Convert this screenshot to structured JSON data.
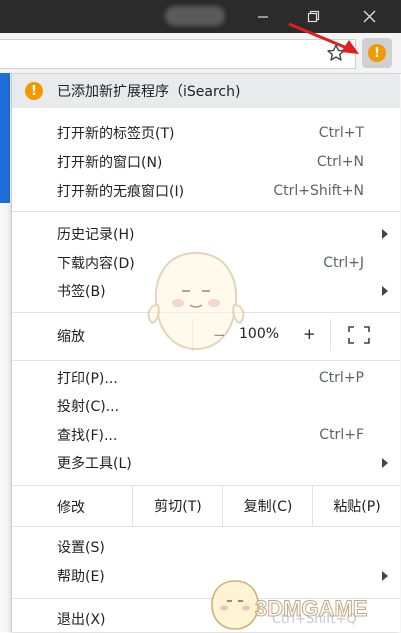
{
  "colors": {
    "accent": "#f29900",
    "blue": "#1e6fd9",
    "titlebar": "#2b2b2b"
  },
  "window_controls": {
    "minimize": "—",
    "maximize": "❐",
    "close": "✕"
  },
  "toolbar": {
    "bookmark_icon": "star-icon",
    "extension_icon": "alert-icon",
    "extension_glyph": "!"
  },
  "menu": {
    "notice": {
      "icon": "!",
      "text": "已添加新扩展程序（iSearch)"
    },
    "items": [
      {
        "label": "打开新的标签页(T)",
        "shortcut": "Ctrl+T"
      },
      {
        "label": "打开新的窗口(N)",
        "shortcut": "Ctrl+N"
      },
      {
        "label": "打开新的无痕窗口(I)",
        "shortcut": "Ctrl+Shift+N"
      },
      {
        "label": "历史记录(H)",
        "shortcut": ""
      },
      {
        "label": "下载内容(D)",
        "shortcut": "Ctrl+J"
      },
      {
        "label": "书签(B)",
        "shortcut": ""
      },
      {
        "label": "打印(P)...",
        "shortcut": "Ctrl+P"
      },
      {
        "label": "投射(C)...",
        "shortcut": ""
      },
      {
        "label": "查找(F)...",
        "shortcut": "Ctrl+F"
      },
      {
        "label": "更多工具(L)",
        "shortcut": ""
      },
      {
        "label": "设置(S)",
        "shortcut": ""
      },
      {
        "label": "帮助(E)",
        "shortcut": ""
      },
      {
        "label": "退出(X)",
        "shortcut": ""
      }
    ],
    "zoom": {
      "label": "缩放",
      "minus": "−",
      "value": "100%",
      "plus": "+"
    },
    "edit": {
      "label": "修改",
      "cut": "剪切(T)",
      "copy": "复制(C)",
      "paste": "粘贴(P)"
    }
  },
  "watermark": {
    "text": "3DMGAME",
    "partial_shortcut": "Ctrl+Shift+Q"
  }
}
